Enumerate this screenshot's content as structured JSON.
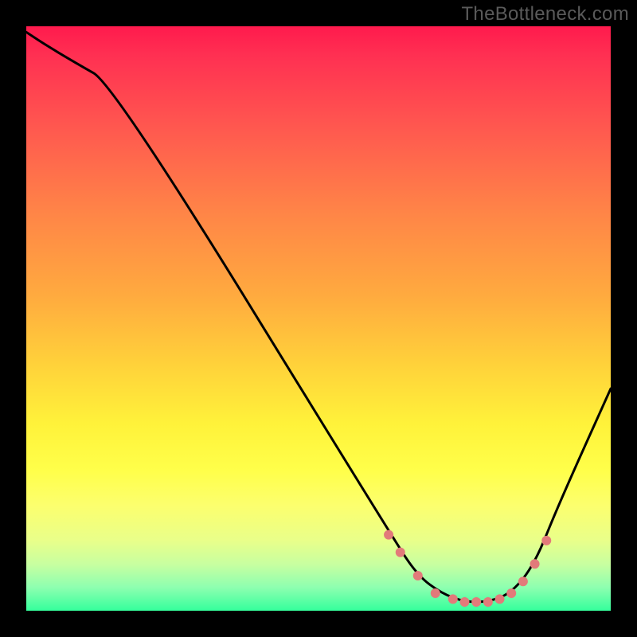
{
  "watermark": "TheBottleneck.com",
  "chart_data": {
    "type": "line",
    "title": "",
    "xlabel": "",
    "ylabel": "",
    "xlim": [
      0,
      100
    ],
    "ylim": [
      0,
      100
    ],
    "series": [
      {
        "name": "bottleneck-curve",
        "x": [
          0,
          3,
          8,
          15,
          63,
          67,
          71,
          75,
          79,
          83,
          87,
          91,
          100
        ],
        "values": [
          99,
          97,
          94,
          90,
          12,
          6,
          3,
          1.5,
          1.5,
          3,
          8,
          18,
          38
        ]
      }
    ],
    "markers": {
      "name": "highlight-dots",
      "color": "#e27a7a",
      "x": [
        62,
        64,
        67,
        70,
        73,
        75,
        77,
        79,
        81,
        83,
        85,
        87,
        89
      ],
      "values": [
        13,
        10,
        6,
        3,
        2,
        1.5,
        1.5,
        1.5,
        2,
        3,
        5,
        8,
        12
      ]
    }
  },
  "colors": {
    "background": "#000000",
    "curve": "#000000",
    "gradient_top": "#ff1a4d",
    "gradient_bottom": "#34ff9c",
    "marker": "#e27a7a"
  }
}
